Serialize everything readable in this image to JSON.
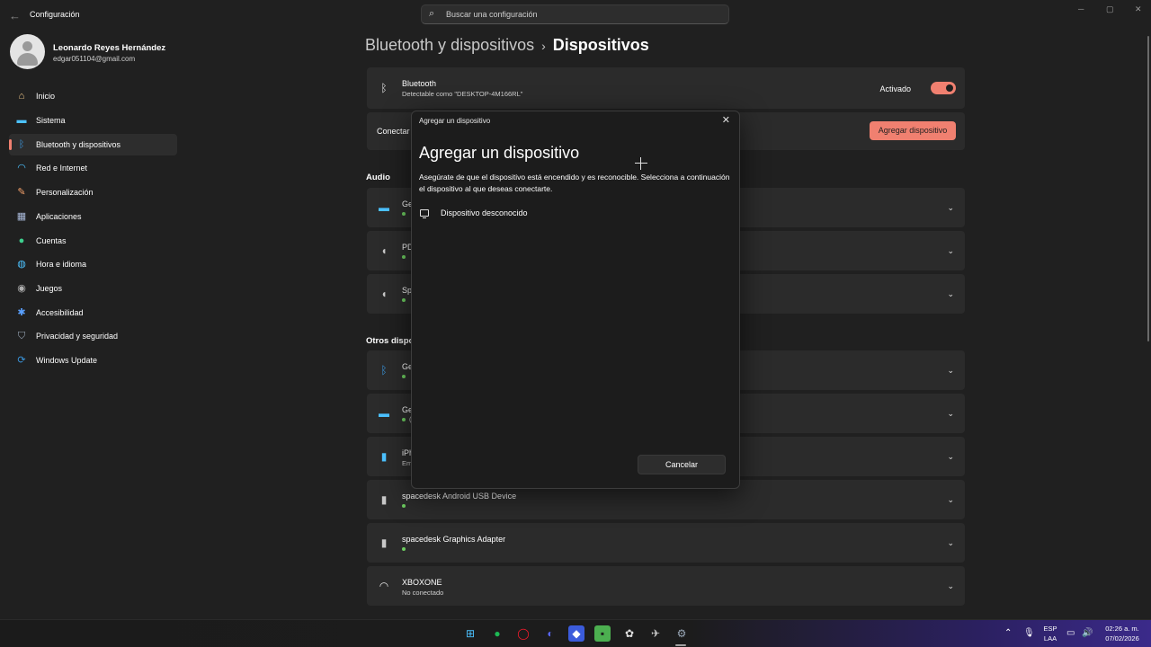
{
  "window": {
    "title": "Configuración",
    "back_icon": "back-arrow-icon",
    "controls": [
      "minimize",
      "maximize",
      "close"
    ]
  },
  "search": {
    "placeholder": "Buscar una configuración",
    "icon": "search-icon"
  },
  "profile": {
    "name": "Leonardo Reyes Hernández",
    "email": "edgar051104@gmail.com"
  },
  "sidebar": {
    "items": [
      {
        "label": "Inicio",
        "icon": "home-icon",
        "color": "#f2c98a"
      },
      {
        "label": "Sistema",
        "icon": "monitor-icon",
        "color": "#4cc2ff"
      },
      {
        "label": "Bluetooth y dispositivos",
        "icon": "bluetooth-icon",
        "color": "#3a96dd",
        "active": true
      },
      {
        "label": "Red e Internet",
        "icon": "wifi-icon",
        "color": "#4cc2ff"
      },
      {
        "label": "Personalización",
        "icon": "brush-icon",
        "color": "#f7a26b"
      },
      {
        "label": "Aplicaciones",
        "icon": "apps-icon",
        "color": "#a8b8d8"
      },
      {
        "label": "Cuentas",
        "icon": "person-icon",
        "color": "#3ecf8e"
      },
      {
        "label": "Hora e idioma",
        "icon": "globe-clock-icon",
        "color": "#4cc2ff"
      },
      {
        "label": "Juegos",
        "icon": "gamepad-icon",
        "color": "#b0b0b0"
      },
      {
        "label": "Accesibilidad",
        "icon": "accessibility-icon",
        "color": "#5aa0ff"
      },
      {
        "label": "Privacidad y seguridad",
        "icon": "shield-icon",
        "color": "#9aa8b8"
      },
      {
        "label": "Windows Update",
        "icon": "update-icon",
        "color": "#3a96dd"
      }
    ]
  },
  "breadcrumb": {
    "parent": "Bluetooth y dispositivos",
    "separator": "›",
    "current": "Dispositivos"
  },
  "bluetooth_card": {
    "title": "Bluetooth",
    "subtitle": "Detectable como \"DESKTOP-4M166RL\"",
    "toggle_label": "Activado",
    "toggle_on": true
  },
  "connect_card": {
    "label": "Conectar",
    "button": "Agregar dispositivo"
  },
  "sections": {
    "audio": "Audio",
    "other": "Otros dispo"
  },
  "audio_devices": [
    {
      "name": "Ge",
      "icon": "monitor-icon"
    },
    {
      "name": "PD",
      "icon": "speaker-icon"
    },
    {
      "name": "Sp",
      "icon": "speaker-icon"
    }
  ],
  "other_devices": [
    {
      "name": "Ge",
      "sub": "",
      "icon": "bluetooth-icon"
    },
    {
      "name": "Ge",
      "sub": "(",
      "icon": "monitor-icon"
    },
    {
      "name": "iPh",
      "sub": "Em",
      "icon": "phone-icon"
    },
    {
      "name": "spacedesk Android USB Device",
      "sub": "",
      "icon": "device-icon"
    },
    {
      "name": "spacedesk Graphics Adapter",
      "sub": "",
      "icon": "device-icon"
    },
    {
      "name": "XBOXONE",
      "sub": "No conectado",
      "icon": "network-icon"
    }
  ],
  "dialog": {
    "title": "Agregar un dispositivo",
    "heading": "Agregar un dispositivo",
    "description": "Asegúrate de que el dispositivo está encendido y es reconocible. Selecciona a continuación el dispositivo al que deseas conectarte.",
    "devices": [
      {
        "label": "Dispositivo desconocido",
        "icon": "monitor-icon"
      }
    ],
    "cancel": "Cancelar"
  },
  "taskbar": {
    "apps": [
      {
        "name": "start",
        "icon": "windows-icon",
        "color": "#4cc2ff"
      },
      {
        "name": "spotify",
        "icon": "spotify-icon",
        "color": "#1db954"
      },
      {
        "name": "opera",
        "icon": "opera-icon",
        "color": "#ff1b2d"
      },
      {
        "name": "discord",
        "icon": "discord-icon",
        "color": "#5865f2"
      },
      {
        "name": "roblox",
        "icon": "roblox-icon",
        "color": "#3b5bdb"
      },
      {
        "name": "minecraft",
        "icon": "minecraft-icon",
        "color": "#4caf50"
      },
      {
        "name": "chatgpt",
        "icon": "chatgpt-icon",
        "color": "#e0e0e0"
      },
      {
        "name": "other",
        "icon": "app-icon",
        "color": "#d0d0d0"
      },
      {
        "name": "settings",
        "icon": "gear-icon",
        "color": "#9aa8b8"
      }
    ],
    "lang_top": "ESP",
    "lang_bottom": "LAA",
    "time": "02:26 a. m.",
    "date": "07/02/2026"
  }
}
